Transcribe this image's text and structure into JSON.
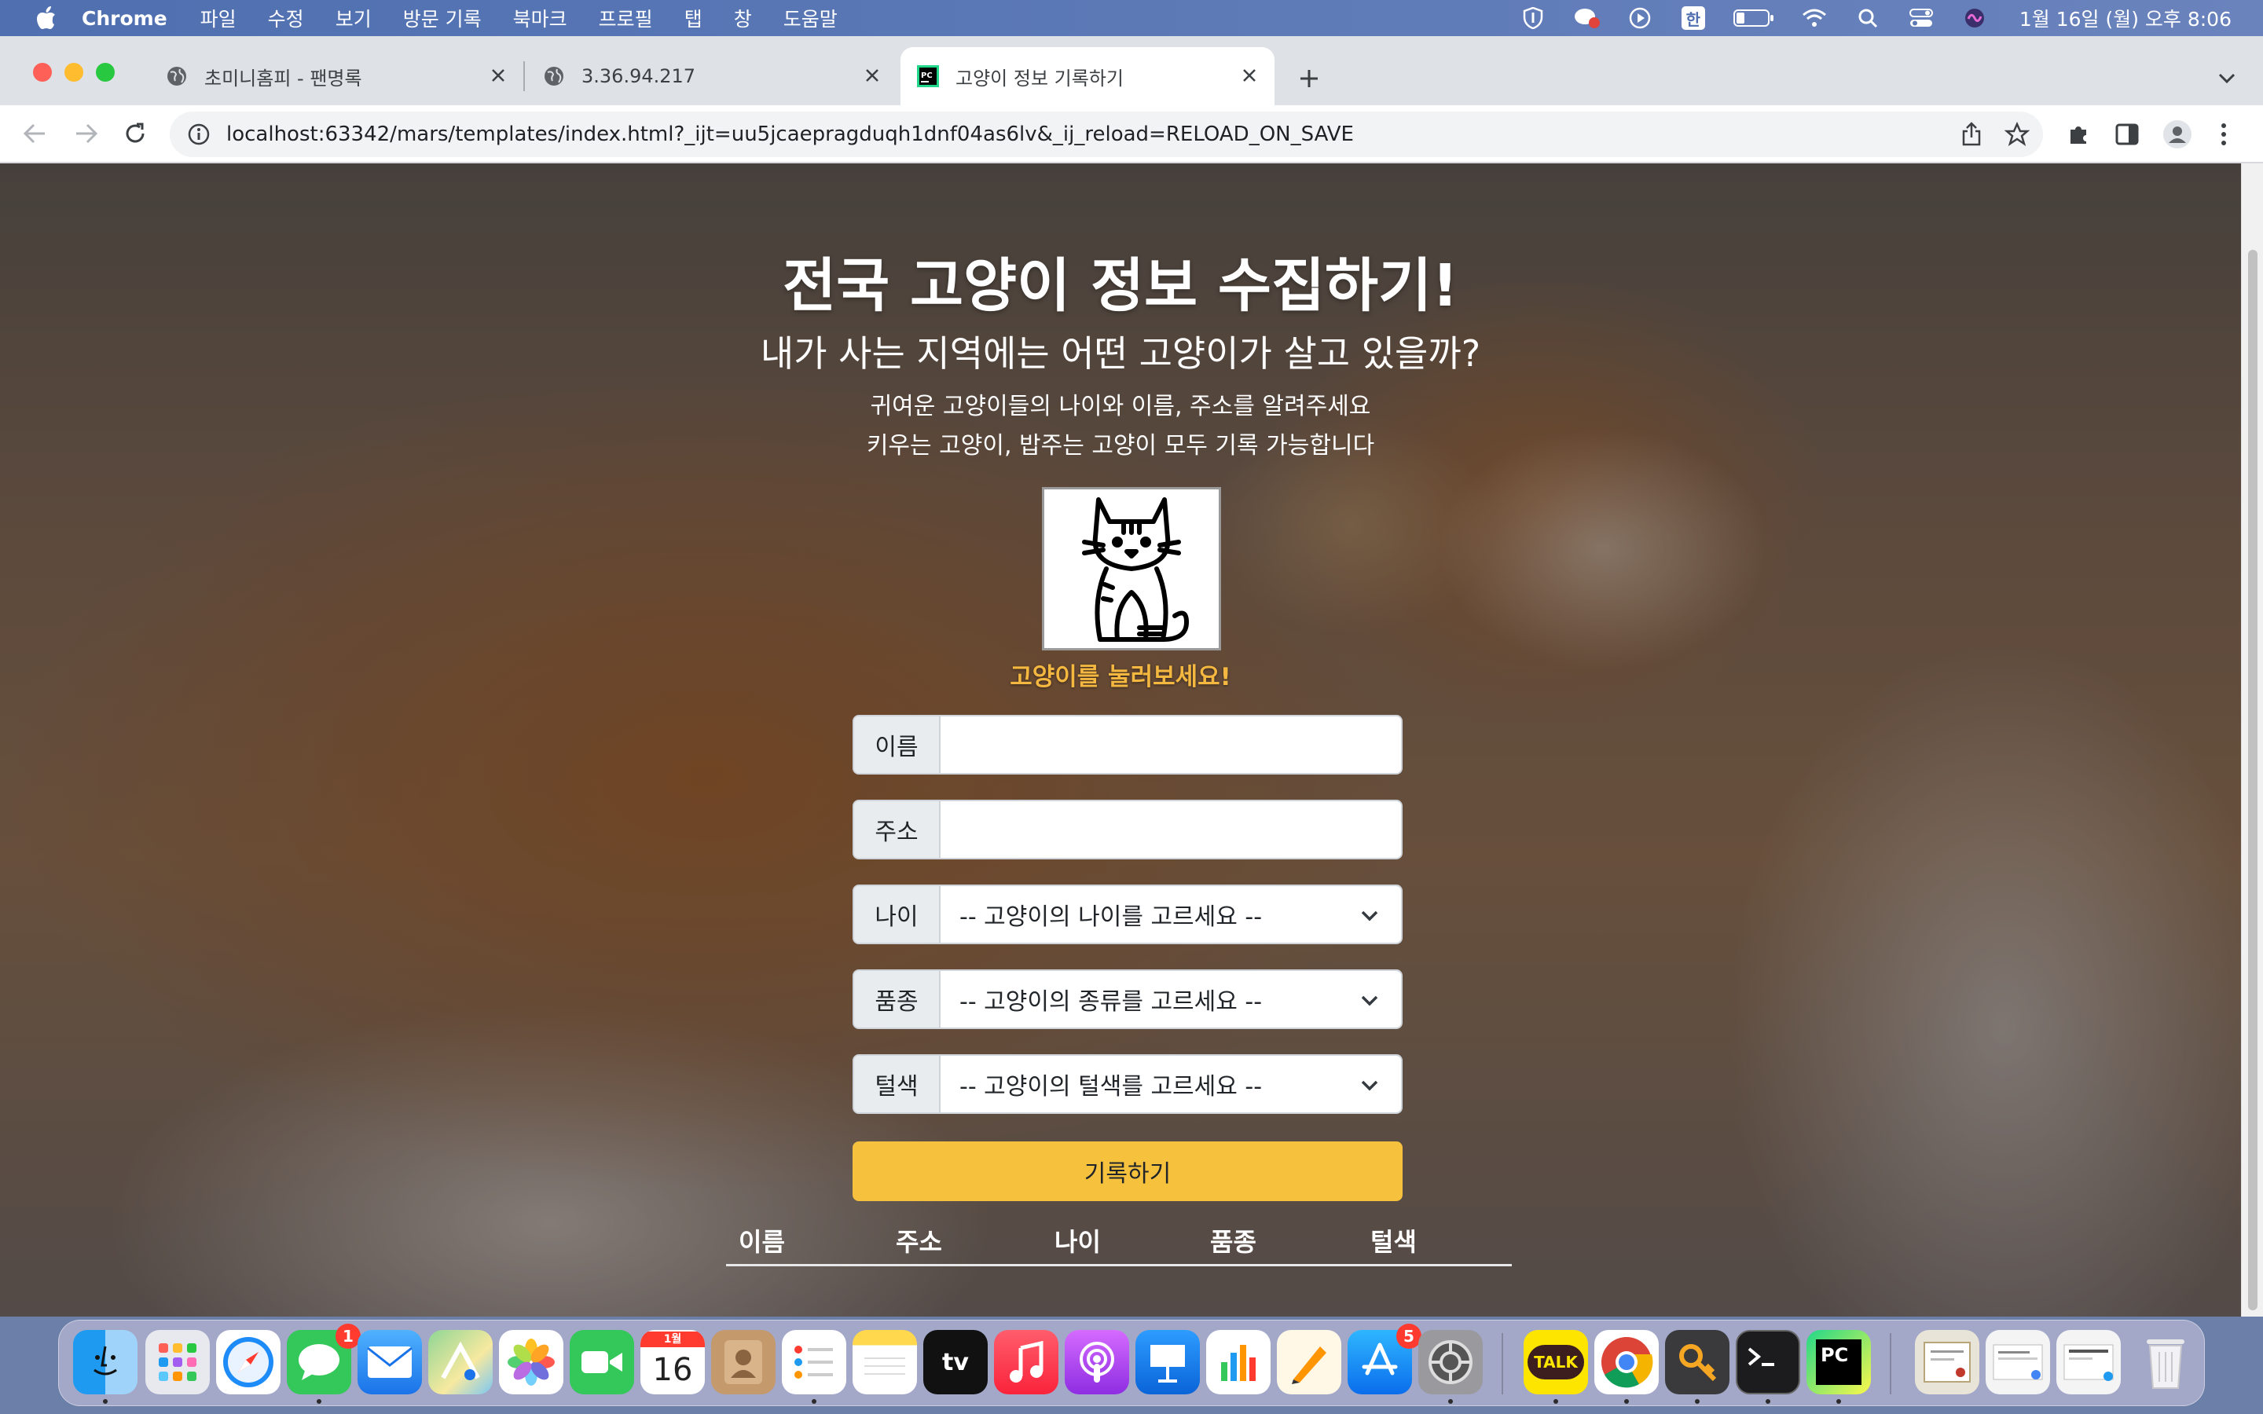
{
  "menubar": {
    "app_name": "Chrome",
    "items": [
      "파일",
      "수정",
      "보기",
      "방문 기록",
      "북마크",
      "프로필",
      "탭",
      "창",
      "도움말"
    ],
    "input_method": "한",
    "clock": "1월 16일 (월) 오후 8:06"
  },
  "browser": {
    "tabs": [
      {
        "title": "초미니홈피 - 팬명록"
      },
      {
        "title": "3.36.94.217"
      },
      {
        "title": "고양이 정보 기록하기"
      }
    ],
    "url": "localhost:63342/mars/templates/index.html?_ijt=uu5jcaepragduqh1dnf04as6lv&_ij_reload=RELOAD_ON_SAVE"
  },
  "page": {
    "title": "전국 고양이 정보 수집하기!",
    "subtitle": "내가 사는 지역에는 어떤 고양이가 살고 있을까?",
    "desc_line1": "귀여운 고양이들의 나이와 이름, 주소를 알려주세요",
    "desc_line2": "키우는 고양이, 밥주는 고양이 모두 기록 가능합니다",
    "cat_hint": "고양이를 눌러보세요!",
    "form": {
      "name_label": "이름",
      "name_value": "",
      "address_label": "주소",
      "address_value": "",
      "age_label": "나이",
      "age_selected": "-- 고양이의 나이를 고르세요 --",
      "breed_label": "품종",
      "breed_selected": "-- 고양이의 종류를 고르세요 --",
      "color_label": "털색",
      "color_selected": "-- 고양이의 털색를 고르세요 --",
      "submit_label": "기록하기"
    },
    "table": {
      "headers": [
        "이름",
        "주소",
        "나이",
        "품종",
        "털색"
      ]
    }
  },
  "dock": {
    "messages_badge": "1",
    "calendar_month": "1월",
    "calendar_day": "16",
    "tv_label": "tv",
    "appstore_badge": "5",
    "kakao_label": "TALK",
    "pycharm_label": "PC"
  },
  "colors": {
    "accent_button": "#f6c23e",
    "cat_hint": "#f4b73f",
    "menubar": "#5c79b6"
  }
}
